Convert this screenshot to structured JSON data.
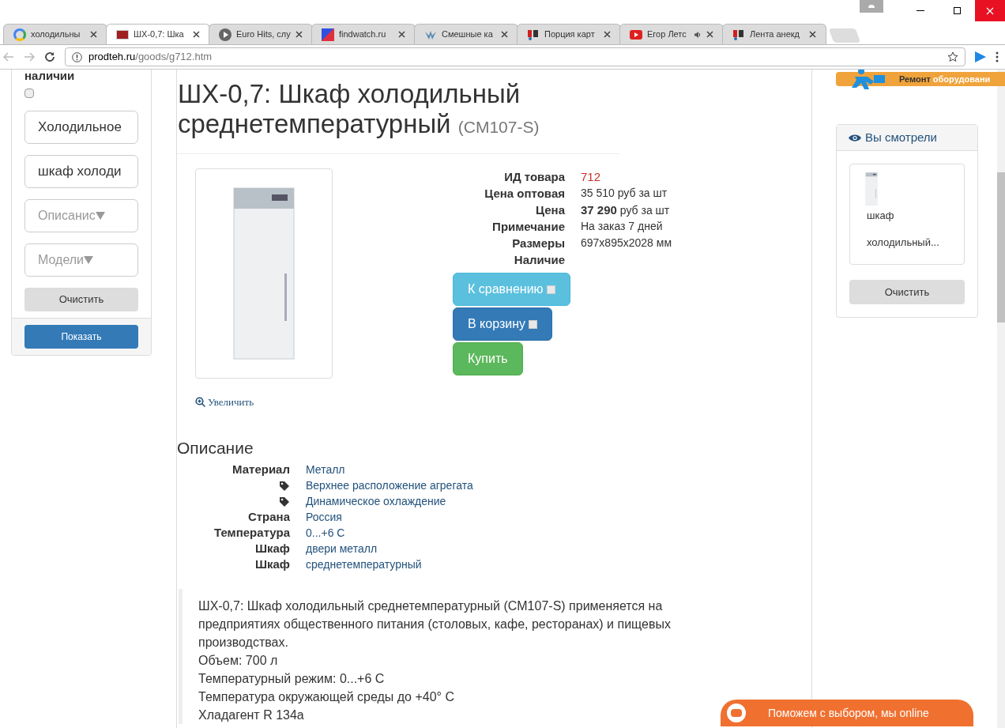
{
  "browser": {
    "tabs": [
      {
        "title": "холодильны",
        "kind": "google",
        "selected": false,
        "audio": false
      },
      {
        "title": "ШХ-0,7: Шка",
        "kind": "site",
        "selected": true,
        "audio": false
      },
      {
        "title": "Euro Hits, слу",
        "kind": "play",
        "selected": false,
        "audio": false
      },
      {
        "title": "findwatch.ru",
        "kind": "square",
        "selected": false,
        "audio": false
      },
      {
        "title": "Смешные ка",
        "kind": "wing",
        "selected": false,
        "audio": false
      },
      {
        "title": "Порция карт",
        "kind": "yap",
        "selected": false,
        "audio": false
      },
      {
        "title": "Егор Летс",
        "kind": "youtube",
        "selected": false,
        "audio": true
      },
      {
        "title": "Лента анекд",
        "kind": "yap",
        "selected": false,
        "audio": false
      }
    ],
    "url": {
      "host": "prodteh.ru",
      "path": "/goods/g712.htm"
    }
  },
  "sidebar": {
    "heading": "наличии",
    "checkbox": {
      "checked": false
    },
    "fields": [
      {
        "kind": "input",
        "value": "Холодильное"
      },
      {
        "kind": "input",
        "value": "шкаф холоди"
      },
      {
        "kind": "select",
        "value": "Описанис"
      },
      {
        "kind": "select",
        "value": "Модели"
      }
    ],
    "clear_button": "Очистить",
    "show_button": "Показать"
  },
  "product": {
    "title": "ШХ-0,7: Шкаф холодильный среднетемпературный",
    "model": "(CM107-S)",
    "zoom_link": "Увеличить",
    "specs": [
      {
        "label": "ИД товара",
        "value": "712",
        "kind": "id"
      },
      {
        "label": "Цена оптовая",
        "value": "35 510 руб за шт",
        "kind": "text"
      },
      {
        "label": "Цена",
        "value": "**37 290** руб за шт",
        "kind": "text"
      },
      {
        "label": "Примечание",
        "value": "На заказ 7 дней",
        "kind": "text"
      },
      {
        "label": "Размеры",
        "value": "697x895x2028 мм",
        "kind": "text"
      },
      {
        "label": "Наличие"
      }
    ],
    "buttons": [
      {
        "label": "К сравнению",
        "kind": "compare"
      },
      {
        "label": "В корзину",
        "kind": "cart"
      },
      {
        "label": "Купить",
        "kind": "buy"
      }
    ]
  },
  "description": {
    "heading": "Описание",
    "attributes": [
      {
        "kind": "label",
        "label": "Материал",
        "value": "Металл"
      },
      {
        "kind": "tag",
        "value": "Верхнее расположение агрегата"
      },
      {
        "kind": "tag",
        "value": "Динамическое охлаждение"
      },
      {
        "kind": "label",
        "label": "Страна",
        "value": "Россия"
      },
      {
        "kind": "label",
        "label": "Температура",
        "value": "0...+6 С"
      },
      {
        "kind": "label",
        "label": "Шкаф",
        "value": "двери металл"
      },
      {
        "kind": "label",
        "label": "Шкаф",
        "value": "среднетемпературный"
      }
    ],
    "lines": [
      "ШХ-0,7: Шкаф холодильный среднетемпературный (CM107-S) применяется на предприятиях общественного питания (столовых, кафе, ресторанах) и пищевых производствах.",
      "Объем: 700 л",
      "Температурный режим: 0...+6 С",
      "Температура окружающей среды до +40° С",
      "Хладагент R 134a"
    ]
  },
  "right": {
    "banner": {
      "first": "Ремонт",
      "second": "оборудовани"
    },
    "viewed": {
      "title": "Вы смотрели",
      "item": "шкаф холодильный...",
      "clear_button": "Очистить"
    }
  },
  "chat": {
    "label": "Поможем с выбором, мы online"
  }
}
